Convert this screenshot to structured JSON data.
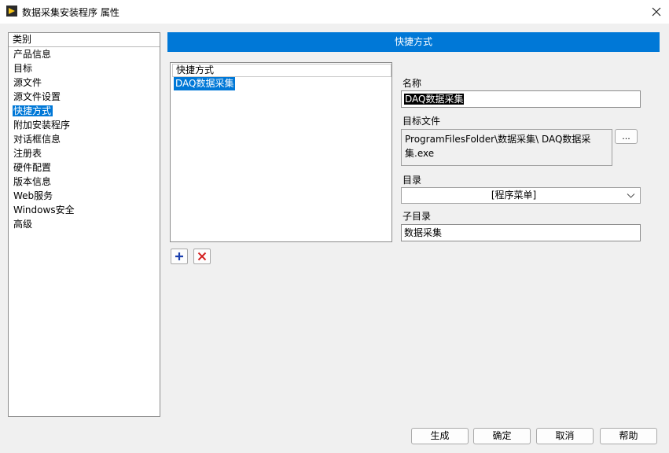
{
  "window": {
    "title": "数据采集安装程序 属性",
    "close_icon": "close-icon"
  },
  "categories": {
    "header": "类别",
    "items": [
      {
        "label": "产品信息",
        "selected": false
      },
      {
        "label": "目标",
        "selected": false
      },
      {
        "label": "源文件",
        "selected": false
      },
      {
        "label": "源文件设置",
        "selected": false
      },
      {
        "label": "快捷方式",
        "selected": true
      },
      {
        "label": "附加安装程序",
        "selected": false
      },
      {
        "label": "对话框信息",
        "selected": false
      },
      {
        "label": "注册表",
        "selected": false
      },
      {
        "label": "硬件配置",
        "selected": false
      },
      {
        "label": "版本信息",
        "selected": false
      },
      {
        "label": "Web服务",
        "selected": false
      },
      {
        "label": "Windows安全",
        "selected": false
      },
      {
        "label": "高级",
        "selected": false
      }
    ]
  },
  "section": {
    "title": "快捷方式"
  },
  "shortcuts": {
    "header": "快捷方式",
    "items": [
      "DAQ数据采集"
    ]
  },
  "form": {
    "name_label": "名称",
    "name_value": "DAQ数据采集",
    "target_label": "目标文件",
    "target_value": "ProgramFilesFolder\\数据采集\\ DAQ数据采集.exe",
    "browse_label": "...",
    "dir_label": "目录",
    "dir_value": "[程序菜单]",
    "subdir_label": "子目录",
    "subdir_value": "数据采集"
  },
  "buttons": {
    "build": "生成",
    "ok": "确定",
    "cancel": "取消",
    "help": "帮助"
  },
  "colors": {
    "accent": "#0078d7",
    "add_icon": "#1a3fae",
    "remove_icon": "#d32020"
  }
}
